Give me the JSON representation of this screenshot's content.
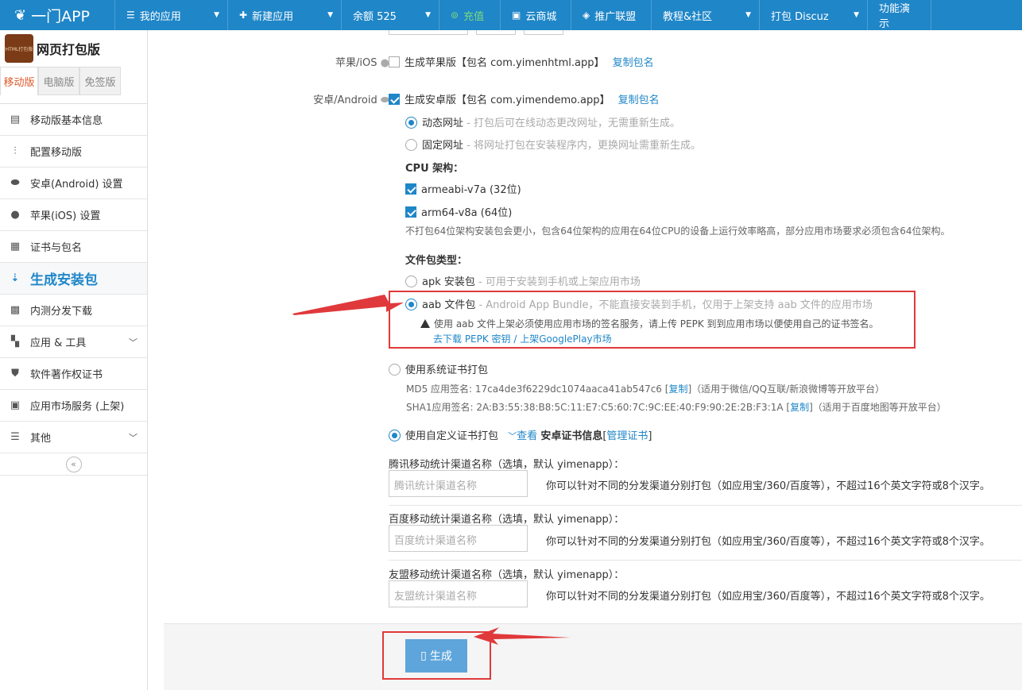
{
  "topnav": {
    "brand": "一门APP",
    "items": [
      {
        "label": "我的应用",
        "icon": "menu-icon",
        "caret": true
      },
      {
        "label": "新建应用",
        "icon": "plus-icon",
        "caret": true
      },
      {
        "label": "余额 525",
        "icon": "",
        "caret": true
      },
      {
        "label": "充值",
        "icon": "recharge-icon",
        "caret": false
      },
      {
        "label": "云商城",
        "icon": "shop-icon",
        "caret": false
      },
      {
        "label": "推广联盟",
        "icon": "diamond-icon",
        "caret": false
      },
      {
        "label": "教程&社区",
        "icon": "",
        "caret": true
      },
      {
        "label": "打包 Discuz",
        "icon": "",
        "caret": true
      },
      {
        "label": "功能演示",
        "icon": "",
        "caret": false
      }
    ]
  },
  "sidebar": {
    "app_logo_text": "HTML打包版",
    "app_name": "网页打包版",
    "tabs": [
      "移动版",
      "电脑版",
      "免签版"
    ],
    "items": [
      {
        "label": "移动版基本信息",
        "icon": "document-icon"
      },
      {
        "label": "配置移动版",
        "icon": "sliders-icon"
      },
      {
        "label": "安卓(Android) 设置",
        "icon": "android-icon"
      },
      {
        "label": "苹果(iOS) 设置",
        "icon": "apple-icon"
      },
      {
        "label": "证书与包名",
        "icon": "certificate-icon"
      },
      {
        "label": "生成安装包",
        "icon": "sort-download-icon"
      },
      {
        "label": "内测分发下载",
        "icon": "qrcode-icon"
      },
      {
        "label": "应用 & 工具",
        "icon": "grid-icon"
      },
      {
        "label": "软件著作权证书",
        "icon": "copyright-shield-icon"
      },
      {
        "label": "应用市场服务 (上架)",
        "icon": "market-icon"
      },
      {
        "label": "其他",
        "icon": "bars-icon"
      }
    ],
    "collapse": "«"
  },
  "ios": {
    "label": "苹果/iOS",
    "checkbox_text": "生成苹果版【包名 com.yimenhtml.app】",
    "copy_link": "复制包名"
  },
  "android": {
    "label": "安卓/Android",
    "checkbox_text": "生成安卓版【包名 com.yimendemo.app】",
    "copy_link": "复制包名",
    "dynamic_url": "动态网址",
    "dynamic_hint": " - 打包后可在线动态更改网址，无需重新生成。",
    "fixed_url": "固定网址",
    "fixed_hint": " - 将网址打包在安装程序内，更换网址需重新生成。",
    "cpu_title": "CPU 架构：",
    "cpu1": "armeabi-v7a (32位)",
    "cpu2": "arm64-v8a (64位)",
    "cpu_note": "不打包64位架构安装包会更小，包含64位架构的应用在64位CPU的设备上运行效率略高，部分应用市场要求必须包含64位架构。",
    "filetype_title": "文件包类型：",
    "apk": "apk 安装包",
    "apk_hint": " - 可用于安装到手机或上架应用市场",
    "aab": "aab 文件包",
    "aab_hint": " - Android App Bundle，不能直接安装到手机，仅用于上架支持 aab 文件的应用市场",
    "aab_warn": "使用 aab 文件上架必须使用应用市场的签名服务，请上传 PEPK 到到应用市场以便使用自己的证书签名。",
    "aab_link1": "去下载 PEPK 密钥",
    "aab_link_sep": " / ",
    "aab_link2": "上架GooglePlay市场",
    "sys_cert": "使用系统证书打包",
    "md5_prefix": "MD5 应用签名: 17ca4de3f6229dc1074aaca41ab547c6 [",
    "md5_copy": "复制",
    "md5_suffix": "]（适用于微信/QQ互联/新浪微博等开放平台）",
    "sha1_prefix": "SHA1应用签名: 2A:B3:55:38:B8:5C:11:E7:C5:60:7C:9C:EE:40:F9:90:2E:2B:F3:1A [",
    "sha1_copy": "复制",
    "sha1_suffix": "]（适用于百度地图等开放平台）",
    "custom_cert": "使用自定义证书打包",
    "view": "查看",
    "cert_info": "安卓证书信息",
    "manage_open": "[",
    "manage": "管理证书",
    "manage_close": "]"
  },
  "channels": [
    {
      "title": "腾讯移动统计渠道名称（选填，默认 yimenapp）：",
      "placeholder": "腾讯统计渠道名称",
      "note": "你可以针对不同的分发渠道分别打包（如应用宝/360/百度等），不超过16个英文字符或8个汉字。"
    },
    {
      "title": "百度移动统计渠道名称（选填，默认 yimenapp）：",
      "placeholder": "百度统计渠道名称",
      "note": "你可以针对不同的分发渠道分别打包（如应用宝/360/百度等），不超过16个英文字符或8个汉字。"
    },
    {
      "title": "友盟移动统计渠道名称（选填，默认 yimenapp）：",
      "placeholder": "友盟统计渠道名称",
      "note": "你可以针对不同的分发渠道分别打包（如应用宝/360/百度等），不超过16个英文字符或8个汉字。"
    }
  ],
  "generate_button": "生成",
  "colors": {
    "primary": "#1f86c8",
    "annotation": "#e0393b",
    "button": "#5ea5db"
  }
}
